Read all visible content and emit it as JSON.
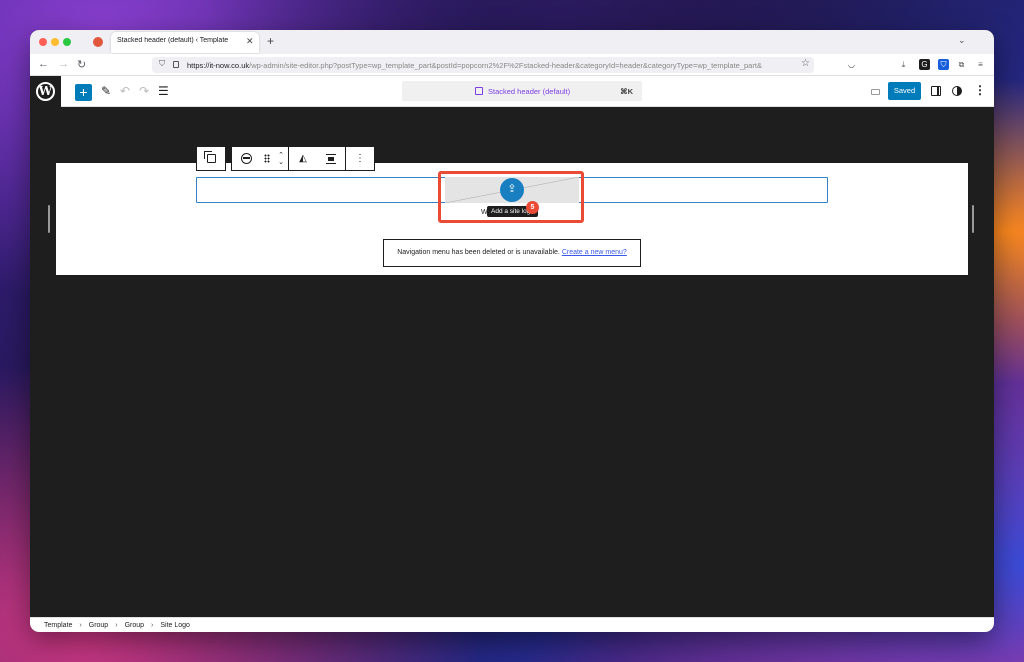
{
  "browser": {
    "tab_title": "Stacked header (default) ‹ Template",
    "tab_close": "✕",
    "new_tab": "+",
    "url_host": "https://it-now.co.uk",
    "url_path": "/wp-admin/site-editor.php?postType=wp_template_part&postId=popcorn2%2F%2Fstacked-header&categoryId=header&categoryType=wp_template_part&",
    "extensions": [
      {
        "icon": "pocket-icon",
        "glyph": "◡"
      },
      {
        "icon": "download-icon",
        "glyph": "⤓"
      },
      {
        "icon": "grammarly-extension-icon",
        "glyph": "G"
      },
      {
        "icon": "bitwarden-extension-icon",
        "glyph": "⛉"
      },
      {
        "icon": "extensions-puzzle-icon",
        "glyph": "⧉"
      },
      {
        "icon": "hamburger-menu-icon",
        "glyph": "≡"
      }
    ]
  },
  "editor": {
    "document_title": "Stacked header (default)",
    "shortcut": "⌘K",
    "save_label": "Saved",
    "accent_color": "#007cba",
    "template_part_color": "#7b3fe4"
  },
  "canvas": {
    "logo_tooltip": "Add a site logo",
    "behind_tooltip_text": "W",
    "step_badge": "5",
    "highlight_color": "#e94b35",
    "nav_notice": "Navigation menu has been deleted or is unavailable.",
    "nav_notice_link": "Create a new menu?"
  },
  "breadcrumbs": [
    "Template",
    "Group",
    "Group",
    "Site Logo"
  ]
}
